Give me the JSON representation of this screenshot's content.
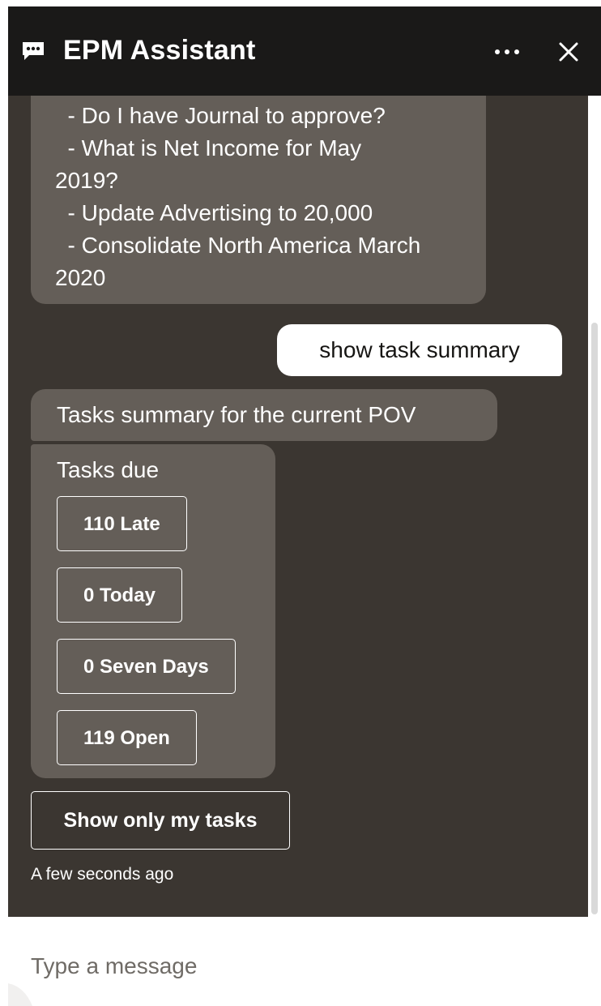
{
  "header": {
    "title": "EPM Assistant",
    "chat_icon": "chat-bubble-icon",
    "more_icon": "more-horizontal-icon",
    "close_icon": "close-icon"
  },
  "conversation": {
    "bot_examples": [
      "  - Do I have Journal to approve?",
      "  - What is Net Income for May",
      "2019?",
      "  - Update Advertising to 20,000",
      "  - Consolidate North America March",
      "2020"
    ],
    "user_message": "show task summary",
    "summary_message": "Tasks summary for the current POV",
    "tasks_card": {
      "title": "Tasks due",
      "buttons": [
        "110 Late",
        "0 Today",
        "0 Seven Days",
        "119 Open"
      ]
    },
    "show_only_my_tasks": "Show only my tasks",
    "timestamp": "A few seconds ago"
  },
  "composer": {
    "placeholder": "Type a message",
    "value": ""
  },
  "colors": {
    "header_bg": "#1a1918",
    "conversation_bg": "#3b3631",
    "bot_bubble": "#645e58",
    "user_bubble": "#ffffff"
  }
}
